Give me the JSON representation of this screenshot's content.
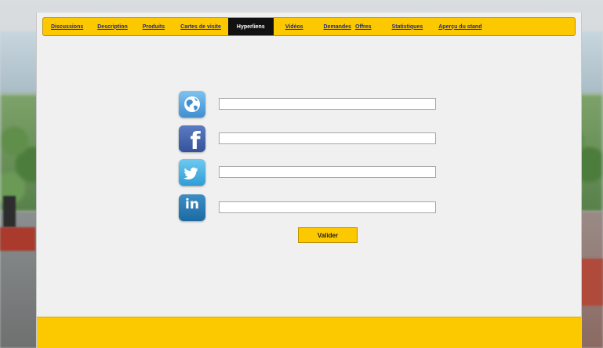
{
  "tabs": [
    {
      "label": "Discussions",
      "active": false
    },
    {
      "label": "Description",
      "active": false
    },
    {
      "label": "Produits",
      "active": false
    },
    {
      "label": "Cartes de visite",
      "active": false
    },
    {
      "label": "Hyperliens",
      "active": true
    },
    {
      "label": "Vidéos",
      "active": false
    },
    {
      "label": "Demandes",
      "active": false
    },
    {
      "label": "Offres",
      "active": false
    },
    {
      "label": "Statistiques",
      "active": false
    },
    {
      "label": "Aperçu du stand",
      "active": false
    }
  ],
  "links": [
    {
      "network": "website",
      "icon": "globe-icon",
      "value": ""
    },
    {
      "network": "facebook",
      "icon": "facebook-icon",
      "glyph": "f",
      "value": ""
    },
    {
      "network": "twitter",
      "icon": "twitter-bird-icon",
      "value": ""
    },
    {
      "network": "linkedin",
      "icon": "linkedin-icon",
      "glyph": "in",
      "value": ""
    }
  ],
  "submit_label": "Valider",
  "colors": {
    "accent": "#fcc800",
    "panel": "#eff0ef",
    "tab_active": "#111111",
    "tab_link": "#1b2a8a"
  }
}
